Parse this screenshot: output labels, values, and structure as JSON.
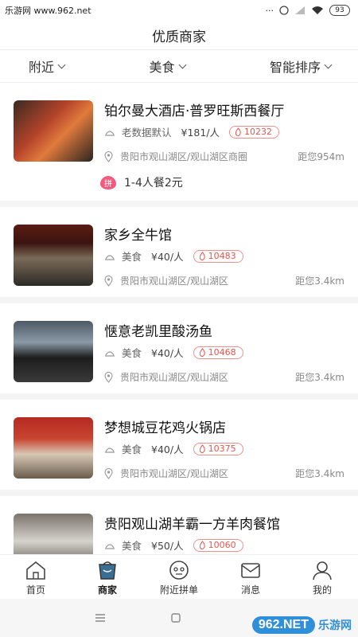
{
  "status_bar": {
    "left_text": "乐游网 www.962.net",
    "battery": "93"
  },
  "header": {
    "title": "优质商家"
  },
  "filters": [
    {
      "label": "附近"
    },
    {
      "label": "美食"
    },
    {
      "label": "智能排序"
    }
  ],
  "shops": [
    {
      "name": "铂尔曼大酒店·普罗旺斯西餐厅",
      "category": "老数据默认",
      "price": "¥181/人",
      "hot": "10232",
      "address": "贵阳市观山湖区/观山湖区商圈",
      "distance": "距您954m",
      "deal": "1-4人餐2元",
      "deal_badge": "拼"
    },
    {
      "name": "家乡全牛馆",
      "category": "美食",
      "price": "¥40/人",
      "hot": "10483",
      "address": "贵阳市观山湖区/观山湖区",
      "distance": "距您3.4km"
    },
    {
      "name": "惬意老凯里酸汤鱼",
      "category": "美食",
      "price": "¥40/人",
      "hot": "10468",
      "address": "贵阳市观山湖区/观山湖区",
      "distance": "距您3.4km"
    },
    {
      "name": "梦想城豆花鸡火锅店",
      "category": "美食",
      "price": "¥40/人",
      "hot": "10375",
      "address": "贵阳市观山湖区/观山湖区",
      "distance": "距您3.4km"
    },
    {
      "name": "贵阳观山湖羊霸一方羊肉餐馆",
      "category": "美食",
      "price": "¥50/人",
      "hot": "10060"
    }
  ],
  "tabbar": [
    {
      "label": "首页",
      "icon": "home-icon"
    },
    {
      "label": "商家",
      "icon": "shop-icon",
      "active": true
    },
    {
      "label": "附近拼单",
      "icon": "nearby-group-icon"
    },
    {
      "label": "消息",
      "icon": "message-icon"
    },
    {
      "label": "我的",
      "icon": "profile-icon"
    }
  ],
  "watermark": {
    "logo": "962",
    "suffix": ".NET",
    "text": "乐游网"
  },
  "colors": {
    "accent": "#e8554e",
    "deal": "#f25b7e",
    "divider": "#f4f4f4"
  }
}
